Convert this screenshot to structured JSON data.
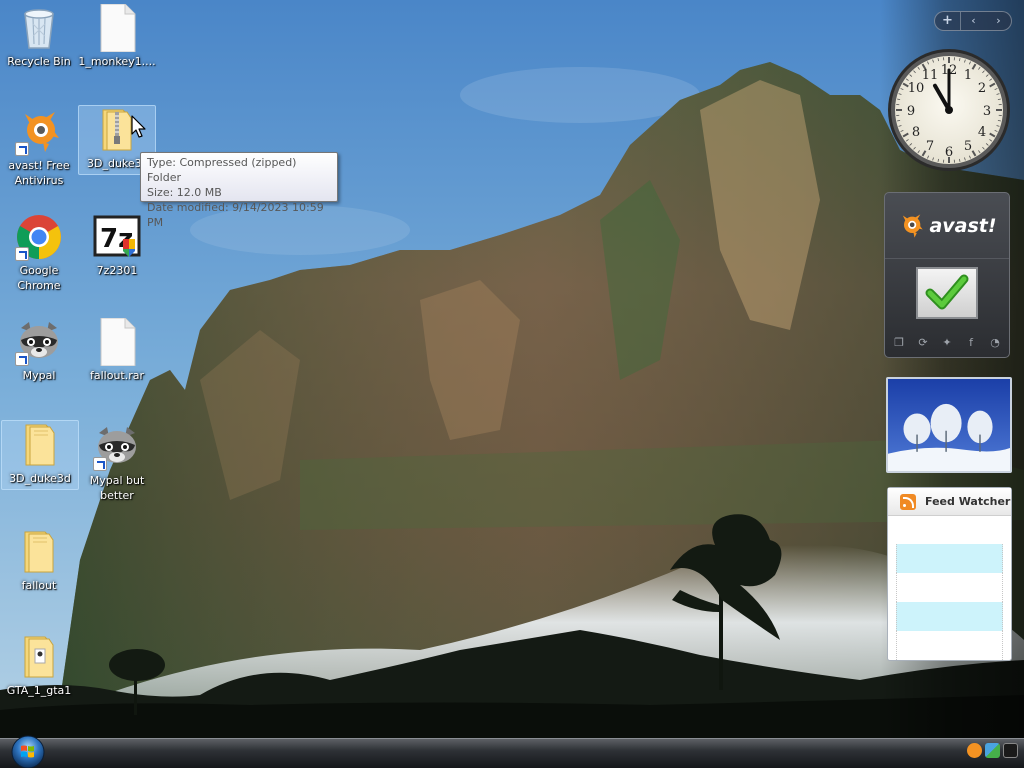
{
  "desktop": {
    "icons": [
      {
        "label": "Recycle Bin"
      },
      {
        "label": "1_monkey1...."
      },
      {
        "label": "avast! Free Antivirus"
      },
      {
        "label": "3D_duke3"
      },
      {
        "label": "Google Chrome"
      },
      {
        "label": "7z2301"
      },
      {
        "label": "Mypal"
      },
      {
        "label": "fallout.rar"
      },
      {
        "label": "3D_duke3d"
      },
      {
        "label": "Mypal but better"
      },
      {
        "label": "fallout"
      },
      {
        "label": "GTA_1_gta1"
      }
    ]
  },
  "tooltip": {
    "type_line": "Type: Compressed (zipped) Folder",
    "size_line": "Size: 12.0 MB",
    "date_line": "Date modified: 9/14/2023 10:59 PM"
  },
  "sidebar": {
    "add_label": "+",
    "prev_label": "‹",
    "next_label": "›",
    "avast_brand": "avast!",
    "feed_title": "Feed Watcher"
  },
  "clock": {
    "hour": 11,
    "minute": 0
  },
  "colors": {
    "selection": "#b4d7f5",
    "feed_highlight": "#cdf3fb",
    "avast_orange": "#f39222",
    "check_green": "#3fae29"
  }
}
